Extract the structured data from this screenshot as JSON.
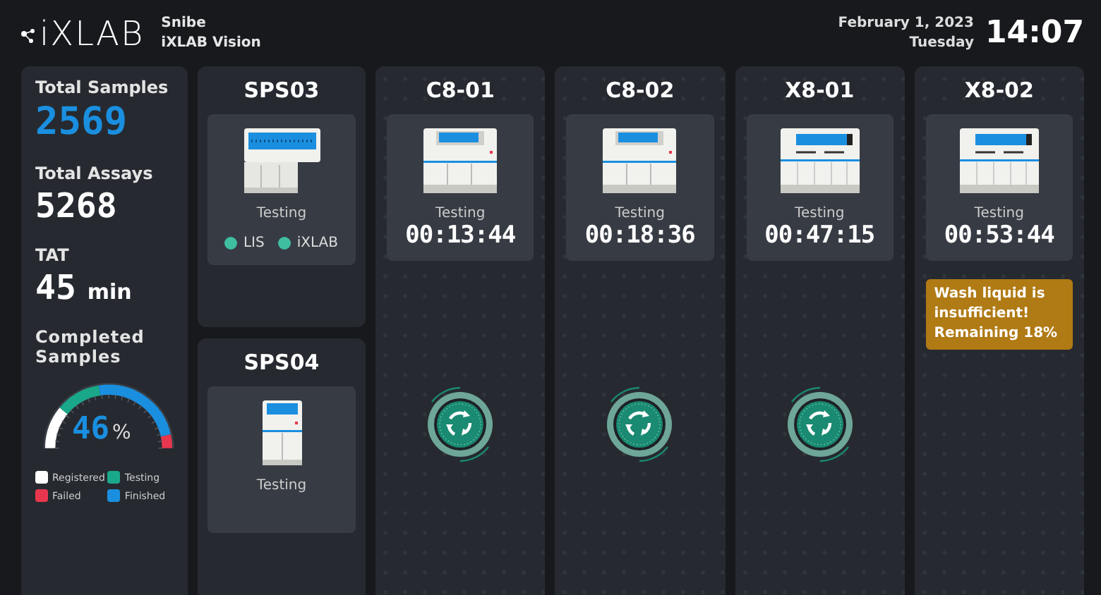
{
  "header": {
    "logo": "iXLAB",
    "company": "Snibe",
    "product": "iXLAB Vision",
    "date": "February 1, 2023",
    "weekday": "Tuesday",
    "time": "14:07"
  },
  "stats": [
    {
      "label": "Total Samples",
      "value": "2569",
      "highlight": true
    },
    {
      "label": "Total Assays",
      "value": "5268",
      "highlight": false
    },
    {
      "label": "TAT",
      "value": "45",
      "unit": "min",
      "highlight": false
    }
  ],
  "completed": {
    "title": "Completed Samples",
    "value": "46",
    "unit": "%",
    "legend": [
      {
        "label": "Registered",
        "color": "#ffffff"
      },
      {
        "label": "Testing",
        "color": "#1aa88a"
      },
      {
        "label": "Failed",
        "color": "#e8364e"
      },
      {
        "label": "Finished",
        "color": "#1a8fe0"
      }
    ]
  },
  "sps": [
    {
      "name": "SPS03",
      "kind": "sps-large",
      "status": "Testing",
      "links": [
        {
          "label": "LIS",
          "color": "#3fbfa0"
        },
        {
          "label": "iXLAB",
          "color": "#3fbfa0"
        }
      ]
    },
    {
      "name": "SPS04",
      "kind": "sps-small",
      "status": "Testing"
    }
  ],
  "analyzers": [
    {
      "name": "C8-01",
      "kind": "c8",
      "status": "Testing",
      "timer": "00:13:44",
      "running": true
    },
    {
      "name": "C8-02",
      "kind": "c8",
      "status": "Testing",
      "timer": "00:18:36",
      "running": true
    },
    {
      "name": "X8-01",
      "kind": "x8",
      "status": "Testing",
      "timer": "00:47:15",
      "running": true
    },
    {
      "name": "X8-02",
      "kind": "x8",
      "status": "Testing",
      "timer": "00:53:44",
      "running": false,
      "alert": "Wash liquid is insufficient! Remaining 18%"
    }
  ]
}
